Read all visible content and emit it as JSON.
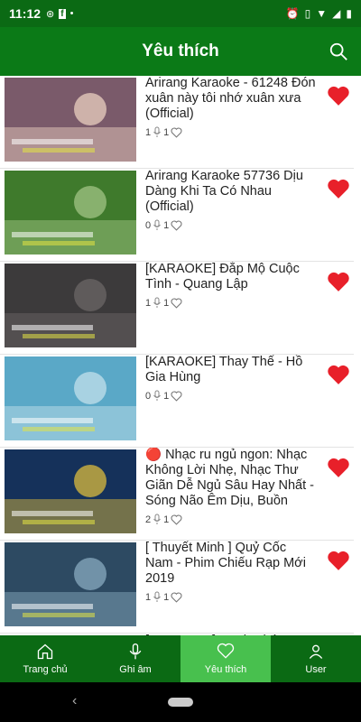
{
  "status_bar": {
    "time": "11:12",
    "left_icons": [
      "alarm-sync-icon",
      "facebook-icon",
      "dot"
    ],
    "right_icons": [
      "alarm-icon",
      "vibrate-icon",
      "wifi-icon",
      "signal-icon",
      "battery-icon"
    ]
  },
  "app_bar": {
    "title": "Yêu thích",
    "search_icon": "search-icon"
  },
  "videos": [
    {
      "title": "Arirang Karaoke - 61248 Đón xuân này tôi nhớ xuân xưa (Official)",
      "likes": "1",
      "favorites": "1",
      "thumb_bg": "#7a5a6a",
      "thumb_accent": "#f2d7c6"
    },
    {
      "title": "Arirang Karaoke 57736 Dịu Dàng Khi Ta Có Nhau (Official)",
      "likes": "0",
      "favorites": "1",
      "thumb_bg": "#3f7a2c",
      "thumb_accent": "#a8c98a"
    },
    {
      "title": "[KARAOKE] Đắp Mộ Cuộc Tình - Quang Lập",
      "likes": "1",
      "favorites": "1",
      "thumb_bg": "#3c3a3b",
      "thumb_accent": "#6e6a6a"
    },
    {
      "title": "[KARAOKE] Thay Thế - Hồ Gia Hùng",
      "likes": "0",
      "favorites": "1",
      "thumb_bg": "#5aa8c7",
      "thumb_accent": "#c9e4ee"
    },
    {
      "title": "🔴 Nhạc ru ngủ ngon: Nhạc Không Lời Nhẹ, Nhạc Thư Giãn Dễ Ngủ Sâu Hay Nhất - Sóng Não Êm Dịu, Buồn",
      "likes": "2",
      "favorites": "1",
      "thumb_bg": "#15315a",
      "thumb_accent": "#e8c43a"
    },
    {
      "title": "[ Thuyết Minh ] Quỷ Cốc Nam - Phim Chiếu Rạp Mới 2019",
      "likes": "1",
      "favorites": "1",
      "thumb_bg": "#2d4a62",
      "thumb_accent": "#8fb1c6"
    },
    {
      "title": "[KARAOKE] Hạnh Phúc",
      "likes": "",
      "favorites": "",
      "thumb_bg": "#444444",
      "thumb_accent": "#888888"
    }
  ],
  "bottom_nav": [
    {
      "label": "Trang chủ",
      "icon": "home-icon"
    },
    {
      "label": "Ghi âm",
      "icon": "mic-icon"
    },
    {
      "label": "Yêu thích",
      "icon": "heart-icon",
      "active": true
    },
    {
      "label": "User",
      "icon": "user-icon"
    }
  ],
  "colors": {
    "appbar": "#0b7a17",
    "active_tab": "#48c04e",
    "heart": "#e8202a"
  }
}
